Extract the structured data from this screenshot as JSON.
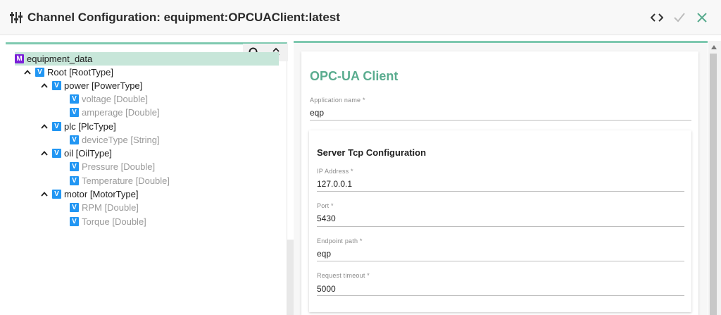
{
  "header": {
    "title": "Channel Configuration: equipment:OPCUAClient:latest"
  },
  "tree": {
    "root": {
      "badge": "M",
      "label": "equipment_data"
    },
    "nodes": [
      {
        "badge": "V",
        "label": "Root [RootType]"
      },
      {
        "badge": "V",
        "label": "power [PowerType]"
      },
      {
        "badge": "V",
        "label": "voltage [Double]"
      },
      {
        "badge": "V",
        "label": "amperage [Double]"
      },
      {
        "badge": "V",
        "label": "plc [PlcType]"
      },
      {
        "badge": "V",
        "label": "deviceType [String]"
      },
      {
        "badge": "V",
        "label": "oil [OilType]"
      },
      {
        "badge": "V",
        "label": "Pressure [Double]"
      },
      {
        "badge": "V",
        "label": "Temperature [Double]"
      },
      {
        "badge": "V",
        "label": "motor [MotorType]"
      },
      {
        "badge": "V",
        "label": "RPM [Double]"
      },
      {
        "badge": "V",
        "label": "Torque [Double]"
      }
    ]
  },
  "form": {
    "title": "OPC-UA Client",
    "app_name": {
      "label": "Application name *",
      "value": "eqp"
    },
    "server": {
      "title": "Server Tcp Configuration",
      "ip": {
        "label": "IP Address *",
        "value": "127.0.0.1"
      },
      "port": {
        "label": "Port *",
        "value": "5430"
      },
      "endpoint": {
        "label": "Endpoint path *",
        "value": "eqp"
      },
      "timeout": {
        "label": "Request timeout *",
        "value": "5000"
      }
    }
  },
  "colors": {
    "accent": "#5aac8f",
    "selected_row": "#c7e6d9",
    "badge_m": "#7a20d8",
    "badge_v": "#2196f3",
    "close_icon": "#5aac8f",
    "check_icon_disabled": "#bdbdbd"
  },
  "icons": {
    "title": "sliders-icon",
    "code": "code-icon",
    "save": "check-icon",
    "close": "close-icon",
    "search": "search-icon",
    "expand_collapse": "unfold-icon",
    "caret": "chevron-up-icon"
  }
}
